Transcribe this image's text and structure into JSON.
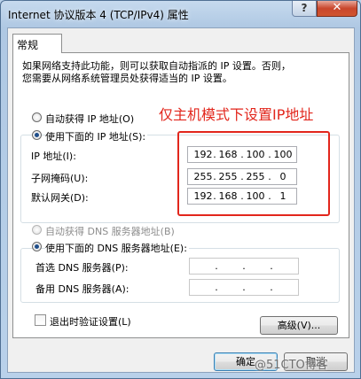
{
  "window": {
    "title": "Internet 协议版本 4 (TCP/IPv4) 属性",
    "help_label": "?",
    "close_label": "✕"
  },
  "tabs": [
    {
      "label": "常规"
    }
  ],
  "description": {
    "line1": "如果网络支持此功能，则可以获取自动指派的 IP 设置。否则，",
    "line2": "您需要从网络系统管理员处获得适当的 IP 设置。"
  },
  "ip_section": {
    "auto_label": "自动获得 IP 地址(O)",
    "manual_label": "使用下面的 IP 地址(S):",
    "selected": "manual",
    "fields": [
      {
        "label": "IP 地址(I):",
        "octets": [
          "192",
          "168",
          "100",
          "100"
        ]
      },
      {
        "label": "子网掩码(U):",
        "octets": [
          "255",
          "255",
          "255",
          "0"
        ]
      },
      {
        "label": "默认网关(D):",
        "octets": [
          "192",
          "168",
          "100",
          "1"
        ]
      }
    ]
  },
  "annotation": {
    "text": "仅主机模式下设置IP地址",
    "color": "#e2261c"
  },
  "dns_section": {
    "auto_label": "自动获得 DNS 服务器地址(B)",
    "manual_label": "使用下面的 DNS 服务器地址(E):",
    "selected": "manual",
    "fields": [
      {
        "label": "首选 DNS 服务器(P):",
        "octets": [
          "",
          "",
          "",
          ""
        ]
      },
      {
        "label": "备用 DNS 服务器(A):",
        "octets": [
          "",
          "",
          "",
          ""
        ]
      }
    ]
  },
  "validate_on_exit": {
    "label": "退出时验证设置(L)",
    "checked": false
  },
  "buttons": {
    "advanced": "高级(V)...",
    "ok": "确定",
    "cancel": "取消"
  },
  "watermark": "@51CTO博客"
}
